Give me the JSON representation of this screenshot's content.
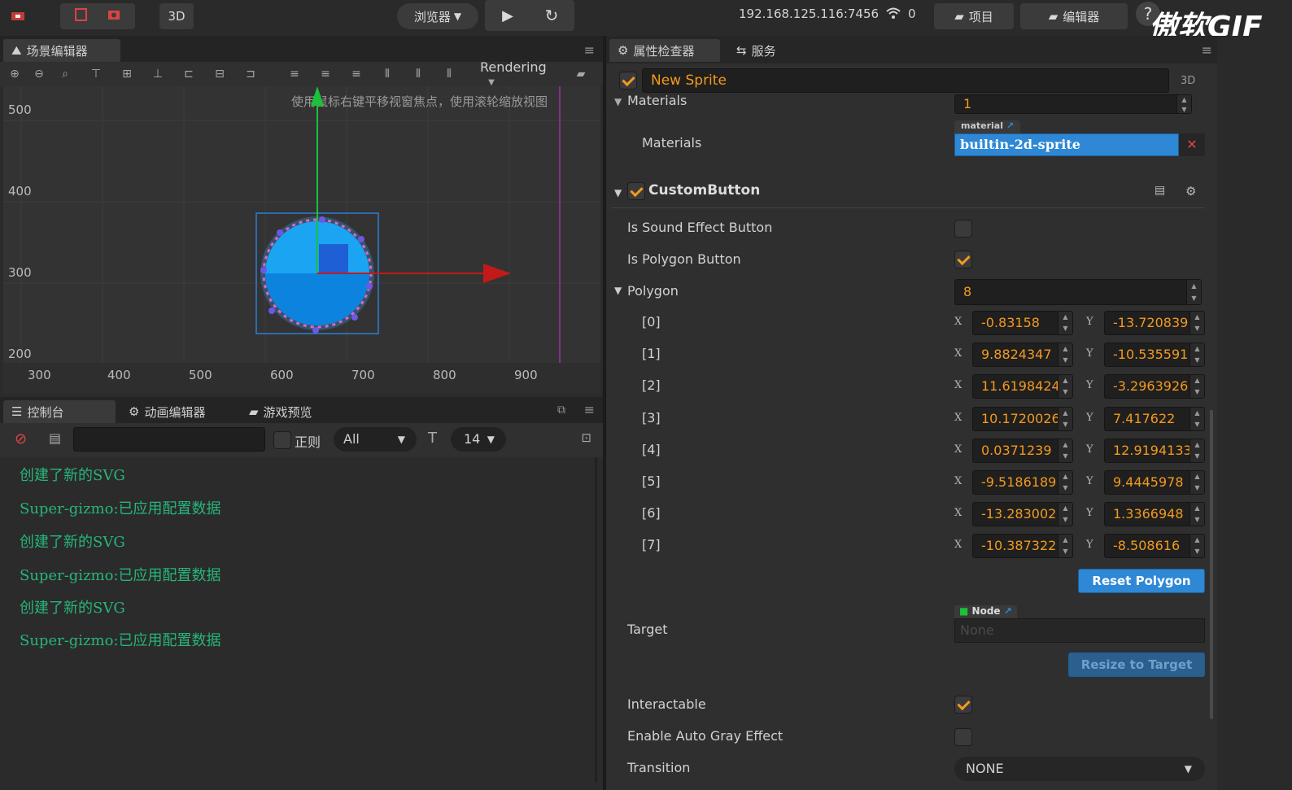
{
  "topbar": {
    "mode_3d": "3D",
    "browser_label": "浏览器",
    "ip_address": "192.168.125.116:7456",
    "wifi_count": "0",
    "project_label": "项目",
    "editor_label": "编辑器",
    "watermark": "傲软GIF"
  },
  "scene": {
    "tab_label": "场景编辑器",
    "rendering_label": "Rendering",
    "hint_text": "使用鼠标右键平移视窗焦点，使用滚轮缩放视图",
    "y_axis_labels": [
      "500",
      "400",
      "300",
      "200"
    ],
    "x_axis_labels": [
      "300",
      "400",
      "500",
      "600",
      "700",
      "800",
      "900"
    ]
  },
  "console": {
    "tabs": [
      "控制台",
      "动画编辑器",
      "游戏预览"
    ],
    "regex_label": "正则",
    "filter_value": "All",
    "font_size": "14",
    "logs": [
      "创建了新的SVG",
      "Super-gizmo:已应用配置数据",
      "创建了新的SVG",
      "Super-gizmo:已应用配置数据",
      "创建了新的SVG",
      "Super-gizmo:已应用配置数据"
    ]
  },
  "inspector": {
    "tabs": [
      "属性检查器",
      "服务"
    ],
    "node_name": "New Sprite",
    "mode_3d": "3D",
    "materials_header": "Materials",
    "materials_count": "1",
    "materials_label": "Materials",
    "material_tag": "material",
    "material_value": "builtin-2d-sprite",
    "component_name": "CustomButton",
    "props": {
      "is_sound": "Is Sound Effect Button",
      "is_polygon": "Is Polygon Button",
      "polygon": "Polygon",
      "polygon_count": "8",
      "target": "Target",
      "node_tag": "Node",
      "target_value": "None",
      "interactable": "Interactable",
      "auto_gray": "Enable Auto Gray Effect",
      "transition": "Transition",
      "transition_value": "NONE"
    },
    "x_label": "X",
    "y_label": "Y",
    "polygon_points": [
      {
        "index": "[0]",
        "x": "-0.83158",
        "y": "-13.720839"
      },
      {
        "index": "[1]",
        "x": "9.8824347",
        "y": "-10.535591"
      },
      {
        "index": "[2]",
        "x": "11.6198424",
        "y": "-3.2963926"
      },
      {
        "index": "[3]",
        "x": "10.1720026",
        "y": "7.417622"
      },
      {
        "index": "[4]",
        "x": "0.0371239",
        "y": "12.9194133"
      },
      {
        "index": "[5]",
        "x": "-9.5186189",
        "y": "9.4445978"
      },
      {
        "index": "[6]",
        "x": "-13.283002",
        "y": "1.3366948"
      },
      {
        "index": "[7]",
        "x": "-10.387322",
        "y": "-8.508616"
      }
    ],
    "reset_button": "Reset Polygon",
    "resize_button": "Resize to Target"
  },
  "colors": {
    "accent_orange": "#f39a1e",
    "log_green": "#26b57a",
    "button_blue": "#2e88d5"
  }
}
